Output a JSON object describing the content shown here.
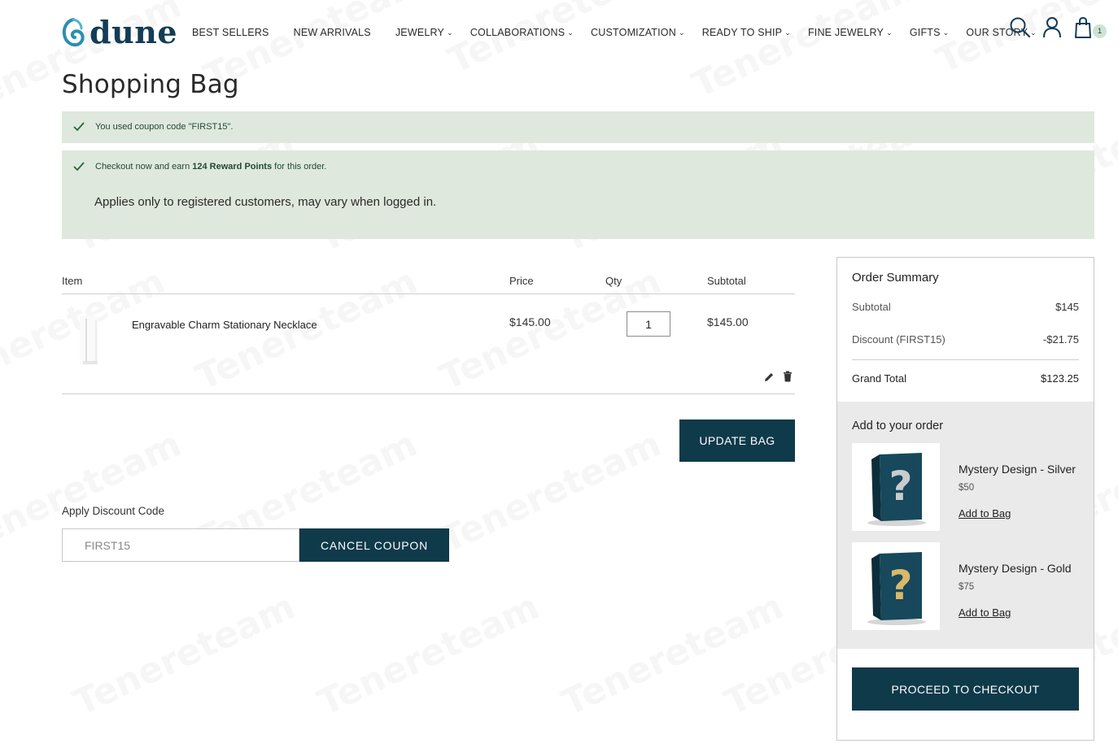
{
  "header": {
    "logo_text": "dune",
    "nav": [
      {
        "label": "BEST SELLERS",
        "has_dropdown": false
      },
      {
        "label": "NEW ARRIVALS",
        "has_dropdown": false
      },
      {
        "label": "JEWELRY",
        "has_dropdown": true
      },
      {
        "label": "COLLABORATIONS",
        "has_dropdown": true
      },
      {
        "label": "CUSTOMIZATION",
        "has_dropdown": true
      },
      {
        "label": "READY TO SHIP",
        "has_dropdown": true
      },
      {
        "label": "FINE JEWELRY",
        "has_dropdown": true
      },
      {
        "label": "GIFTS",
        "has_dropdown": true
      },
      {
        "label": "OUR STORY",
        "has_dropdown": true
      }
    ],
    "icons": [
      "search-icon",
      "account-icon",
      "bag-icon"
    ],
    "cart_count": "1"
  },
  "page": {
    "title": "Shopping Bag"
  },
  "messages": {
    "coupon": "You used coupon code \"FIRST15\".",
    "reward_prefix": "Checkout now and earn ",
    "reward_points": "124 Reward Points",
    "reward_suffix": " for this order.",
    "reward_note": "Applies only to registered customers, may vary when logged in."
  },
  "cart": {
    "columns": {
      "item": "Item",
      "price": "Price",
      "qty": "Qty",
      "subtotal": "Subtotal"
    },
    "items": [
      {
        "name": "Engravable Charm Stationary Necklace",
        "price": "$145.00",
        "qty": "1",
        "subtotal": "$145.00"
      }
    ],
    "update_label": "UPDATE BAG"
  },
  "discount": {
    "label": "Apply Discount Code",
    "value": "FIRST15",
    "cancel_label": "CANCEL COUPON"
  },
  "summary": {
    "title": "Order Summary",
    "subtotal_label": "Subtotal",
    "subtotal_value": "$145",
    "discount_label": "Discount (FIRST15)",
    "discount_value": "-$21.75",
    "total_label": "Grand Total",
    "total_value": "$123.25",
    "upsell_title": "Add to your order",
    "upsell": [
      {
        "name": "Mystery Design - Silver",
        "price": "$50",
        "link": "Add to Bag"
      },
      {
        "name": "Mystery Design - Gold",
        "price": "$75",
        "link": "Add to Bag"
      }
    ],
    "checkout_label": "PROCEED TO CHECKOUT"
  },
  "colors": {
    "brand": "#133c55",
    "button": "#0f3a4a",
    "success_bg": "#dfe8dc",
    "upsell_bg": "#eaeaea"
  }
}
